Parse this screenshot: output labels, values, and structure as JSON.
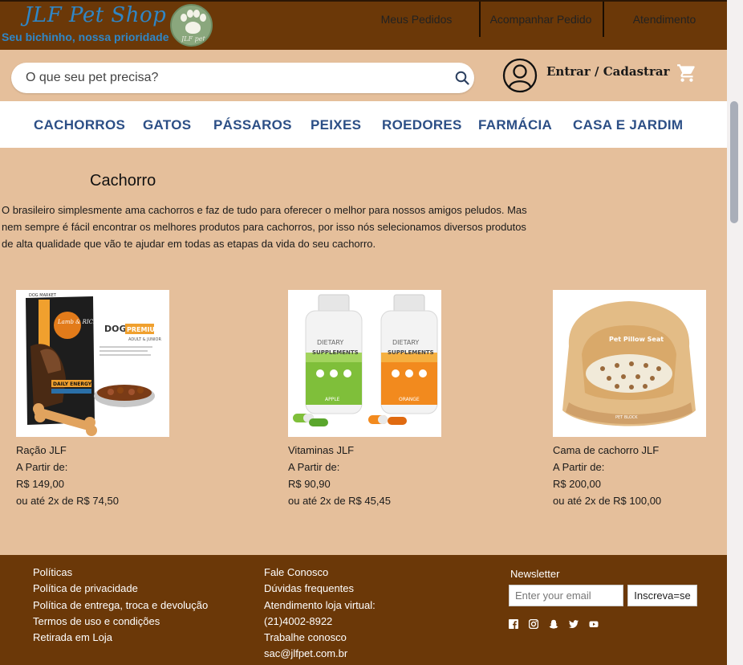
{
  "brand": {
    "name": "JLF Pet Shop",
    "tagline": "Seu bichinho, nossa prioridade",
    "primary_color": "#6b3808",
    "background_color": "#e5bf9b",
    "logo_text_color": "#2f86c6",
    "nav_text_color": "#2c4f86"
  },
  "topnav": {
    "items": [
      "Meus Pedidos",
      "Acompanhar Pedido",
      "Atendimento"
    ]
  },
  "search": {
    "placeholder": "O que seu pet precisa?",
    "icon": "search-icon"
  },
  "account": {
    "login_label": "Entrar / Cadastrar",
    "user_icon": "user-icon",
    "cart_icon": "cart-icon"
  },
  "categories": [
    "CACHORROS",
    "GATOS",
    "PÁSSAROS",
    "PEIXES",
    "ROEDORES",
    "FARMÁCIA",
    "CASA E JARDIM"
  ],
  "main": {
    "title": "Cachorro",
    "intro": "O brasileiro simplesmente ama cachorros e faz de tudo para oferecer o melhor para nossos amigos peludos. Mas nem sempre é fácil encontrar os melhores produtos para cachorros, por isso nós selecionamos diversos produtos de alta qualidade que vão te ajudar em todas as etapas da vida do seu cachorro."
  },
  "products": [
    {
      "name": "Ração JLF",
      "from_label": "A Partir de:",
      "price": "R$ 149,00",
      "installments": "ou até 2x de R$ 74,50",
      "image_text": [
        "DOG",
        "PREMIUM",
        "ADULT & JUNIOR",
        "Lamb & RICE",
        "DAILY ENERGY",
        "DOG MARKET"
      ]
    },
    {
      "name": "Vitaminas JLF",
      "from_label": "A Partir de:",
      "price": "R$ 90,90",
      "installments": "ou até 2x de R$ 45,45",
      "image_text": [
        "DIETARY",
        "SUPPLEMENTS",
        "APPLE",
        "ORANGE"
      ]
    },
    {
      "name": "Cama de cachorro JLF",
      "from_label": "A Partir de:",
      "price": "R$ 200,00",
      "installments": "ou até 2x de R$ 100,00",
      "image_text": [
        "Pet Pillow Seat",
        "PET BLOCK"
      ]
    }
  ],
  "footer": {
    "col1": [
      "Políticas",
      "Política de privacidade",
      "Política de entrega, troca e devolução",
      "Termos de uso e condições",
      "Retirada em Loja"
    ],
    "col2": [
      "Fale Conosco",
      "Dúvidas frequentes",
      "Atendimento loja virtual:",
      "(21)4002-8922",
      "Trabalhe conosco",
      "sac@jlfpet.com.br"
    ],
    "newsletter": {
      "title": "Newsletter",
      "placeholder": "Enter your email",
      "button": "Inscreva=se"
    },
    "social_icons": [
      "facebook-icon",
      "instagram-icon",
      "snapchat-icon",
      "twitter-icon",
      "youtube-icon"
    ]
  }
}
